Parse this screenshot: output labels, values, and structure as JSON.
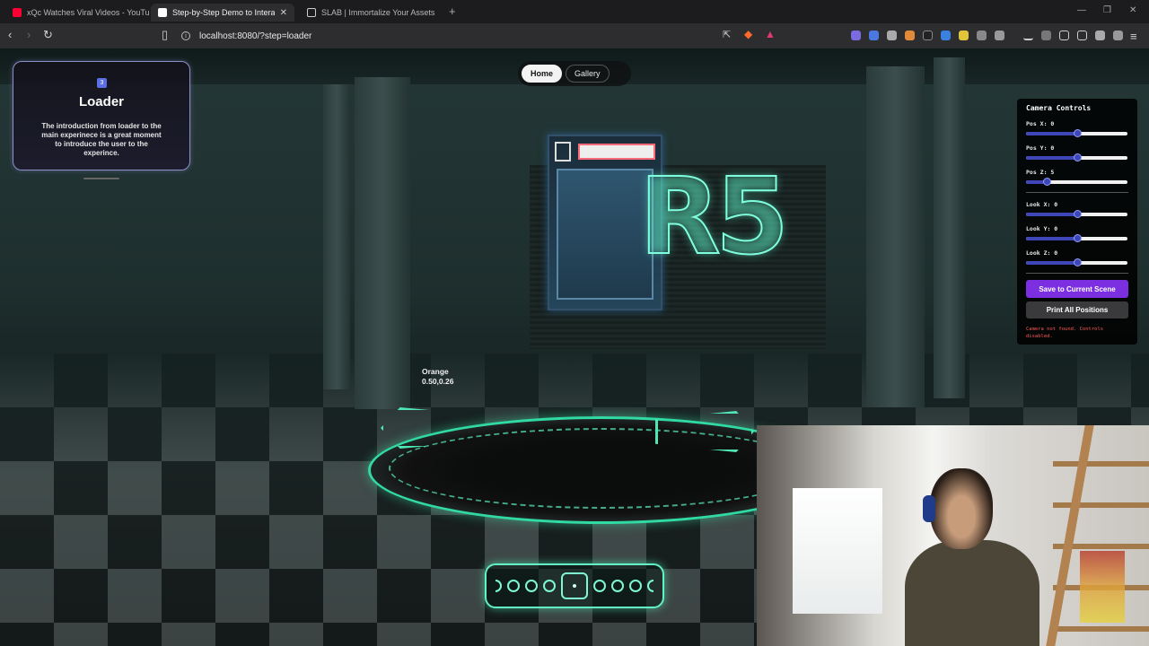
{
  "browser": {
    "tabs": [
      {
        "label": "xQc Watches Viral Videos - YouTube",
        "favicon_color": "#ff0033"
      },
      {
        "label": "Step-by-Step Demo to Interactive",
        "favicon_color": "#ffffff",
        "active": true
      },
      {
        "label": "SLAB | Immortalize Your Assets",
        "favicon_color": "#cccccc"
      }
    ],
    "new_tab": "+",
    "url": "localhost:8080/?step=loader"
  },
  "card": {
    "badge": "3",
    "title": "Loader",
    "text": "The introduction from loader to the main experinece is a great moment to introduce the user to the experince."
  },
  "topnav": {
    "home": "Home",
    "gallery": "Gallery"
  },
  "camera_controls": {
    "title": "Camera Controls",
    "sliders": [
      {
        "label": "Pos X: 0",
        "value": 0.5
      },
      {
        "label": "Pos Y: 0",
        "value": 0.5
      },
      {
        "label": "Pos Z: 5",
        "value": 0.2
      },
      {
        "label": "Look X: 0",
        "value": 0.5
      },
      {
        "label": "Look Y: 0",
        "value": 0.5
      },
      {
        "label": "Look Z: 0",
        "value": 0.5
      }
    ],
    "save_button": "Save to Current Scene",
    "print_button": "Print All Positions",
    "error": "Camera not found. Controls disabled.",
    "accent": "#7c2fe0"
  },
  "debug_label": {
    "name": "Orange",
    "coords": "0.50,0.26"
  },
  "stepper": {
    "steps": 8,
    "active_index": 3
  }
}
